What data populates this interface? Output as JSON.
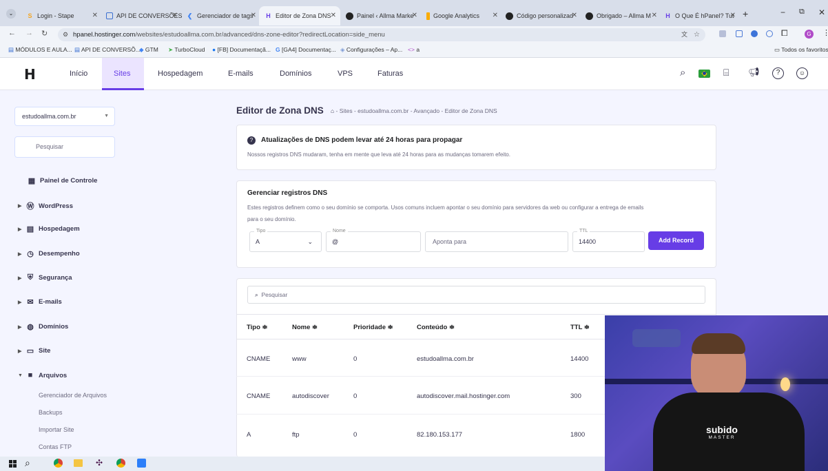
{
  "browser": {
    "tabs": [
      {
        "label": "Login - Stape",
        "icon": "stape-icon"
      },
      {
        "label": "API DE CONVERSÕES",
        "icon": "sheets-icon"
      },
      {
        "label": "Gerenciador de tags",
        "icon": "gtm-icon"
      },
      {
        "label": "Editor de Zona DNS",
        "icon": "hostinger-icon"
      },
      {
        "label": "Painel ‹ Allma Marke",
        "icon": "wordpress-icon"
      },
      {
        "label": "Google Analytics",
        "icon": "analytics-icon"
      },
      {
        "label": "Código personalizad",
        "icon": "wordpress-icon"
      },
      {
        "label": "Obrigado – Allma M",
        "icon": "wordpress-icon"
      },
      {
        "label": "O Que É hPanel? Tut",
        "icon": "hostinger-icon"
      }
    ],
    "url_host": "hpanel.hostinger.com",
    "url_path": "/websites/estudoallma.com.br/advanced/dns-zone-editor?redirectLocation=side_menu",
    "bookmarks": [
      "MÓDULOS E AULA...",
      "API DE CONVERSÕ...",
      "GTM",
      "TurboCloud",
      "[FB] Documentaçã...",
      "[GA4] Documentaç...",
      "Configurações – Ap...",
      "a"
    ],
    "bookmarks_folder": "Todos os favoritos"
  },
  "header": {
    "nav": [
      "Início",
      "Sites",
      "Hospedagem",
      "E-mails",
      "Domínios",
      "VPS",
      "Faturas"
    ],
    "active": "Sites"
  },
  "sidebar": {
    "domain": "estudoallma.com.br",
    "search_placeholder": "Pesquisar",
    "dashboard": "Painel de Controle",
    "items": [
      "WordPress",
      "Hospedagem",
      "Desempenho",
      "Segurança",
      "E-mails",
      "Domínios",
      "Site",
      "Arquivos"
    ],
    "subitems": [
      "Gerenciador de Arquivos",
      "Backups",
      "Importar Site",
      "Contas FTP"
    ]
  },
  "page": {
    "title": "Editor de Zona DNS",
    "breadcrumb": "- Sites - estudoallma.com.br - Avançado - Editor de Zona DNS",
    "notice_title": "Atualizações de DNS podem levar até 24 horas para propagar",
    "notice_text": "Nossos registros DNS mudaram, tenha em mente que leva até 24 horas para as mudanças tomarem efeito.",
    "manage_title": "Gerenciar registros DNS",
    "manage_text_1": "Estes registros definem como o seu domínio se comporta. Usos comuns incluem apontar o seu domínio para servidores da web ou configurar a entrega de emails",
    "manage_text_2": "para o seu domínio.",
    "form": {
      "type_label": "Tipo",
      "type_value": "A",
      "name_label": "Nome",
      "name_value": "@",
      "points_placeholder": "Aponta para",
      "ttl_label": "TTL",
      "ttl_value": "14400",
      "add_button": "Add Record"
    },
    "table_search_placeholder": "Pesquisar",
    "columns": [
      "Tipo ≑",
      "Nome ≑",
      "Prioridade ≑",
      "Conteúdo ≑",
      "TTL ≑"
    ],
    "rows": [
      {
        "type": "CNAME",
        "name": "www",
        "priority": "0",
        "content": "estudoallma.com.br",
        "ttl": "14400"
      },
      {
        "type": "CNAME",
        "name": "autodiscover",
        "priority": "0",
        "content": "autodiscover.mail.hostinger.com",
        "ttl": "300"
      },
      {
        "type": "A",
        "name": "ftp",
        "priority": "0",
        "content": "82.180.153.177",
        "ttl": "1800"
      }
    ]
  },
  "webcam": {
    "shirt_text_1": "subido",
    "shirt_text_2": "MASTER"
  },
  "colors": {
    "accent": "#673de6",
    "sidebar_bg": "#f4f5ff"
  }
}
